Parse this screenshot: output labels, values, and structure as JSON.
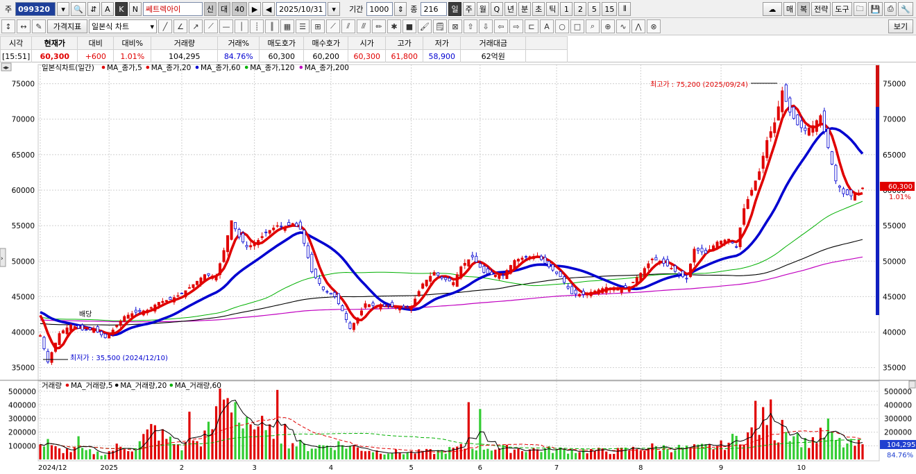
{
  "toolbar": {
    "market_label": "주",
    "code": "099320",
    "mode_buttons": [
      "A",
      "K",
      "N"
    ],
    "stock_name": "쎄트렉아이",
    "badges": [
      "신",
      "대",
      "40"
    ],
    "date": "2025/10/31",
    "period_label": "기간",
    "period_value": "1000",
    "count_label": "종",
    "count_value": "216",
    "timeframes": [
      "일",
      "주",
      "월",
      "Q",
      "년",
      "분",
      "초",
      "틱",
      "1",
      "2",
      "5",
      "15"
    ],
    "right_buttons": [
      "매",
      "복",
      "전략",
      "도구"
    ]
  },
  "toolbar2": {
    "price_indicator": "가격지표",
    "chart_type": "일본식 차트",
    "view_button": "보기"
  },
  "info_table": {
    "headers": [
      "시각",
      "현재가",
      "대비",
      "대비%",
      "거래량",
      "거래%",
      "매도호가",
      "매수호가",
      "시가",
      "고가",
      "저가",
      "거래대금"
    ],
    "values": [
      "[15:51]",
      "60,300",
      "+600",
      "1.01%",
      "104,295",
      "84.76%",
      "60,300",
      "60,200",
      "60,300",
      "61,800",
      "58,900",
      "62억원"
    ]
  },
  "price_panel": {
    "legend_title": "일본식차트(일간)",
    "legend_series": [
      {
        "name": "MA_종가,5",
        "color": "#e00000"
      },
      {
        "name": "MA_종가,20",
        "color": "#e00000"
      },
      {
        "name": "MA_종가,60",
        "color": "#0000d0"
      },
      {
        "name": "MA_종가,120",
        "color": "#00b000"
      },
      {
        "name": "MA_종가,200",
        "color": "#c000c0"
      }
    ],
    "high_annotation": "최고가 : 75,200 (2025/09/24)",
    "low_annotation": "최저가 : 35,500 (2024/12/10)",
    "note_label": "배당",
    "current_price_tag": "60,300",
    "current_change_tag": "1.01%",
    "y_ticks": [
      "75000",
      "70000",
      "65000",
      "60000",
      "55000",
      "50000",
      "45000",
      "40000",
      "35000"
    ]
  },
  "volume_panel": {
    "legend_title": "거래량",
    "legend_series": [
      {
        "name": "MA_거래량,5",
        "color": "#e00000"
      },
      {
        "name": "MA_거래량,20",
        "color": "#000000"
      },
      {
        "name": "MA_거래량,60",
        "color": "#00b000"
      }
    ],
    "current_volume_tag": "104,295",
    "current_ratio_tag": "84.76%",
    "y_ticks": [
      "500000",
      "400000",
      "300000",
      "200000",
      "100000"
    ]
  },
  "x_axis_labels": [
    "2024/12",
    "2025",
    "2",
    "3",
    "4",
    "5",
    "6",
    "7",
    "8",
    "9",
    "10"
  ],
  "chart_data": {
    "type": "candlestick",
    "ylim": [
      33500,
      77500
    ],
    "volume_ylim": [
      0,
      560000
    ],
    "x_ticks": [
      {
        "label": "2024/12",
        "index": 0
      },
      {
        "label": "2025",
        "index": 18
      },
      {
        "label": "2",
        "index": 37
      },
      {
        "label": "3",
        "index": 56
      },
      {
        "label": "4",
        "index": 76
      },
      {
        "label": "5",
        "index": 97
      },
      {
        "label": "6",
        "index": 115
      },
      {
        "label": "7",
        "index": 135
      },
      {
        "label": "8",
        "index": 157
      },
      {
        "label": "9",
        "index": 178
      },
      {
        "label": "10",
        "index": 199
      }
    ],
    "anchors": [
      [
        0,
        39500
      ],
      [
        2,
        35800
      ],
      [
        5,
        39800
      ],
      [
        8,
        41000
      ],
      [
        11,
        40300
      ],
      [
        14,
        40400
      ],
      [
        17,
        39200
      ],
      [
        19,
        40300
      ],
      [
        22,
        42200
      ],
      [
        25,
        42800
      ],
      [
        28,
        43100
      ],
      [
        31,
        44200
      ],
      [
        34,
        44600
      ],
      [
        37,
        45400
      ],
      [
        40,
        46700
      ],
      [
        43,
        48100
      ],
      [
        46,
        47800
      ],
      [
        48,
        51500
      ],
      [
        50,
        55700
      ],
      [
        52,
        53400
      ],
      [
        54,
        52000
      ],
      [
        56,
        52400
      ],
      [
        59,
        54000
      ],
      [
        62,
        55000
      ],
      [
        64,
        54800
      ],
      [
        66,
        55300
      ],
      [
        68,
        54500
      ],
      [
        71,
        48500
      ],
      [
        74,
        46000
      ],
      [
        77,
        45000
      ],
      [
        79,
        43000
      ],
      [
        81,
        40500
      ],
      [
        83,
        42000
      ],
      [
        85,
        44000
      ],
      [
        88,
        43600
      ],
      [
        91,
        43700
      ],
      [
        94,
        43400
      ],
      [
        97,
        43600
      ],
      [
        100,
        46800
      ],
      [
        103,
        48400
      ],
      [
        105,
        47600
      ],
      [
        108,
        47000
      ],
      [
        110,
        49200
      ],
      [
        112,
        50200
      ],
      [
        113,
        50600
      ],
      [
        116,
        48400
      ],
      [
        118,
        48100
      ],
      [
        121,
        48000
      ],
      [
        124,
        50100
      ],
      [
        127,
        50600
      ],
      [
        130,
        50700
      ],
      [
        133,
        49200
      ],
      [
        136,
        47800
      ],
      [
        139,
        45400
      ],
      [
        142,
        45300
      ],
      [
        145,
        45800
      ],
      [
        148,
        46300
      ],
      [
        151,
        46000
      ],
      [
        154,
        46400
      ],
      [
        157,
        48300
      ],
      [
        160,
        50300
      ],
      [
        162,
        50000
      ],
      [
        165,
        49000
      ],
      [
        167,
        48100
      ],
      [
        169,
        47500
      ],
      [
        171,
        51700
      ],
      [
        174,
        51100
      ],
      [
        177,
        52700
      ],
      [
        180,
        53100
      ],
      [
        182,
        52000
      ],
      [
        184,
        57400
      ],
      [
        186,
        60000
      ],
      [
        188,
        62600
      ],
      [
        190,
        67000
      ],
      [
        192,
        69500
      ],
      [
        194,
        74000
      ],
      [
        196,
        71000
      ],
      [
        198,
        69200
      ],
      [
        200,
        68400
      ],
      [
        202,
        69100
      ],
      [
        204,
        70500
      ],
      [
        206,
        66000
      ],
      [
        208,
        61300
      ],
      [
        210,
        59500
      ],
      [
        212,
        59200
      ],
      [
        214,
        59600
      ],
      [
        215,
        60300
      ]
    ],
    "volume_anchors": [
      [
        0,
        110000
      ],
      [
        5,
        70000
      ],
      [
        12,
        60000
      ],
      [
        17,
        40000
      ],
      [
        20,
        90000
      ],
      [
        25,
        80000
      ],
      [
        29,
        240000
      ],
      [
        33,
        150000
      ],
      [
        37,
        90000
      ],
      [
        42,
        140000
      ],
      [
        45,
        240000
      ],
      [
        47,
        380000
      ],
      [
        49,
        420000
      ],
      [
        51,
        300000
      ],
      [
        55,
        190000
      ],
      [
        59,
        170000
      ],
      [
        62,
        220000
      ],
      [
        65,
        130000
      ],
      [
        70,
        90000
      ],
      [
        78,
        110000
      ],
      [
        88,
        60000
      ],
      [
        96,
        50000
      ],
      [
        105,
        60000
      ],
      [
        113,
        100000
      ],
      [
        120,
        80000
      ],
      [
        135,
        70000
      ],
      [
        150,
        60000
      ],
      [
        160,
        90000
      ],
      [
        170,
        80000
      ],
      [
        178,
        100000
      ],
      [
        184,
        180000
      ],
      [
        187,
        200000
      ],
      [
        190,
        320000
      ],
      [
        193,
        160000
      ],
      [
        196,
        220000
      ],
      [
        200,
        120000
      ],
      [
        205,
        180000
      ],
      [
        210,
        110000
      ],
      [
        215,
        104295
      ]
    ],
    "volume_spikes": [
      [
        2,
        150000
      ],
      [
        10,
        170000
      ],
      [
        28,
        220000
      ],
      [
        29,
        260000
      ],
      [
        39,
        350000
      ],
      [
        47,
        520000
      ],
      [
        49,
        450000
      ],
      [
        51,
        420000
      ],
      [
        54,
        310000
      ],
      [
        58,
        320000
      ],
      [
        62,
        510000
      ],
      [
        64,
        260000
      ],
      [
        112,
        420000
      ],
      [
        115,
        370000
      ],
      [
        187,
        430000
      ],
      [
        191,
        440000
      ],
      [
        194,
        290000
      ],
      [
        198,
        190000
      ],
      [
        206,
        300000
      ]
    ],
    "dividend_marker_index": 12,
    "high_index": 190,
    "low_index": 2
  }
}
